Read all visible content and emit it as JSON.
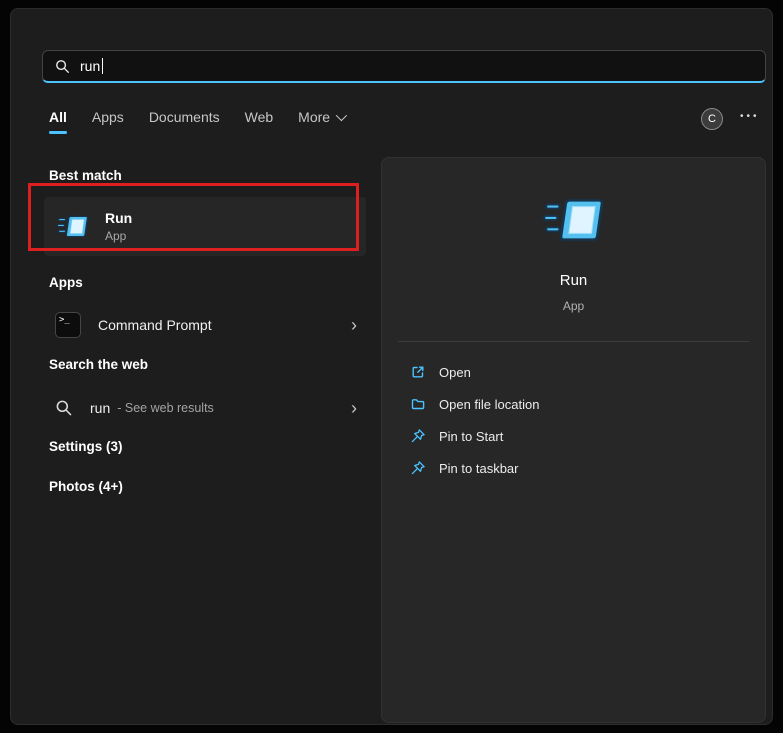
{
  "colors": {
    "accent": "#4cc2ff",
    "annotation": "#dd1f1f"
  },
  "search": {
    "value": "run"
  },
  "tabs": [
    {
      "label": "All",
      "active": true
    },
    {
      "label": "Apps",
      "active": false
    },
    {
      "label": "Documents",
      "active": false
    },
    {
      "label": "Web",
      "active": false
    },
    {
      "label": "More",
      "active": false
    }
  ],
  "profile": {
    "initial": "C"
  },
  "left": {
    "best_match_title": "Best match",
    "best_match": {
      "name": "Run",
      "type": "App"
    },
    "apps_title": "Apps",
    "apps": [
      {
        "label": "Command Prompt"
      }
    ],
    "web_title": "Search the web",
    "web": [
      {
        "query": "run",
        "hint": "- See web results"
      }
    ],
    "settings_group": "Settings (3)",
    "photos_group": "Photos (4+)"
  },
  "preview": {
    "name": "Run",
    "type": "App",
    "actions": [
      {
        "label": "Open"
      },
      {
        "label": "Open file location"
      },
      {
        "label": "Pin to Start"
      },
      {
        "label": "Pin to taskbar"
      }
    ]
  }
}
